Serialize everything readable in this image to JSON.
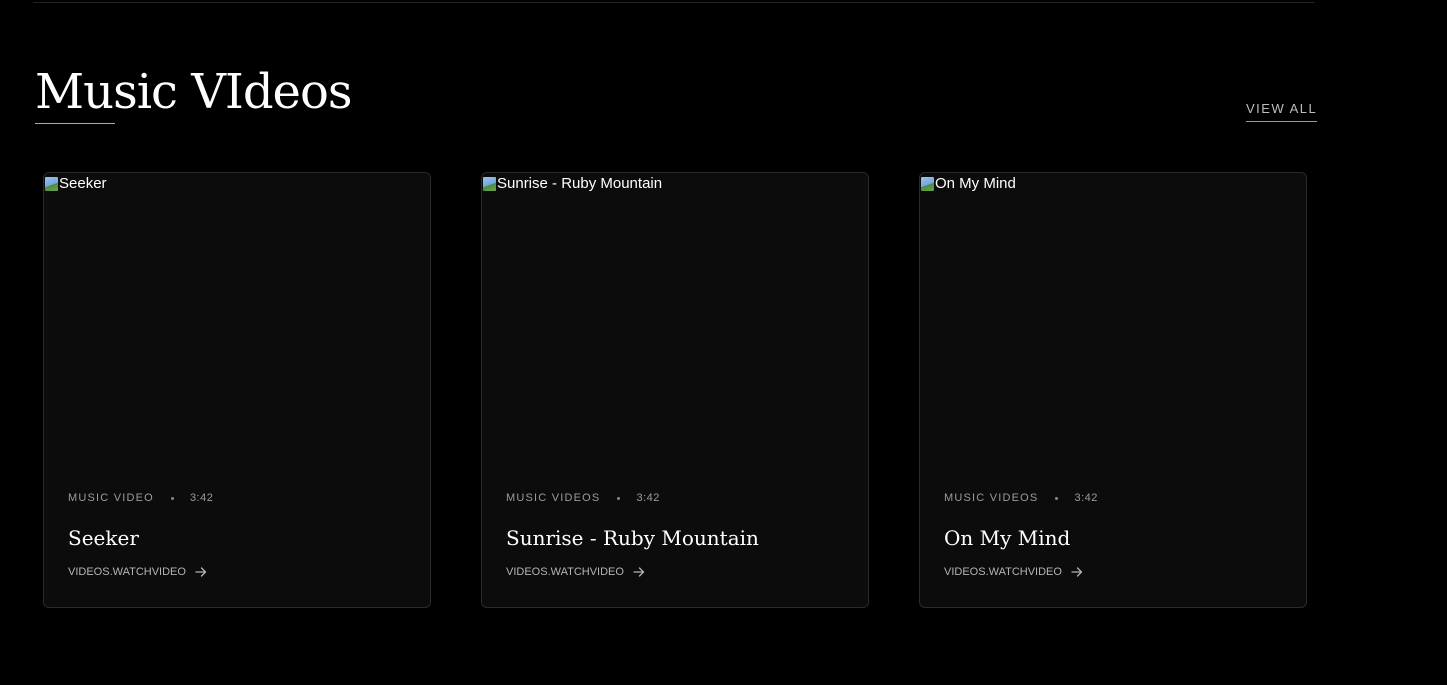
{
  "section": {
    "title": "Music VIdeos",
    "view_all_label": "VIEW ALL"
  },
  "videos": [
    {
      "image_alt": "Seeker",
      "category": "MUSIC VIDEO",
      "duration": "3:42",
      "title": "Seeker",
      "watch_label": "VIDEOS.WATCHVIDEO",
      "icon": "arrow-right-icon"
    },
    {
      "image_alt": "Sunrise - Ruby Mountain",
      "category": "MUSIC VIDEOS",
      "duration": "3:42",
      "title": "Sunrise - Ruby Mountain",
      "watch_label": "VIDEOS.WATCHVIDEO",
      "icon": "arrow-right-icon"
    },
    {
      "image_alt": "On My Mind",
      "category": "MUSIC VIDEOS",
      "duration": "3:42",
      "title": "On My Mind",
      "watch_label": "VIDEOS.WATCHVIDEO",
      "icon": "arrow-right-icon"
    }
  ],
  "colors": {
    "background": "#000000",
    "card_background": "#0c0c0c",
    "card_border": "#2b2b2b",
    "text_primary": "#ffffff",
    "text_muted": "#9c9c9c"
  }
}
